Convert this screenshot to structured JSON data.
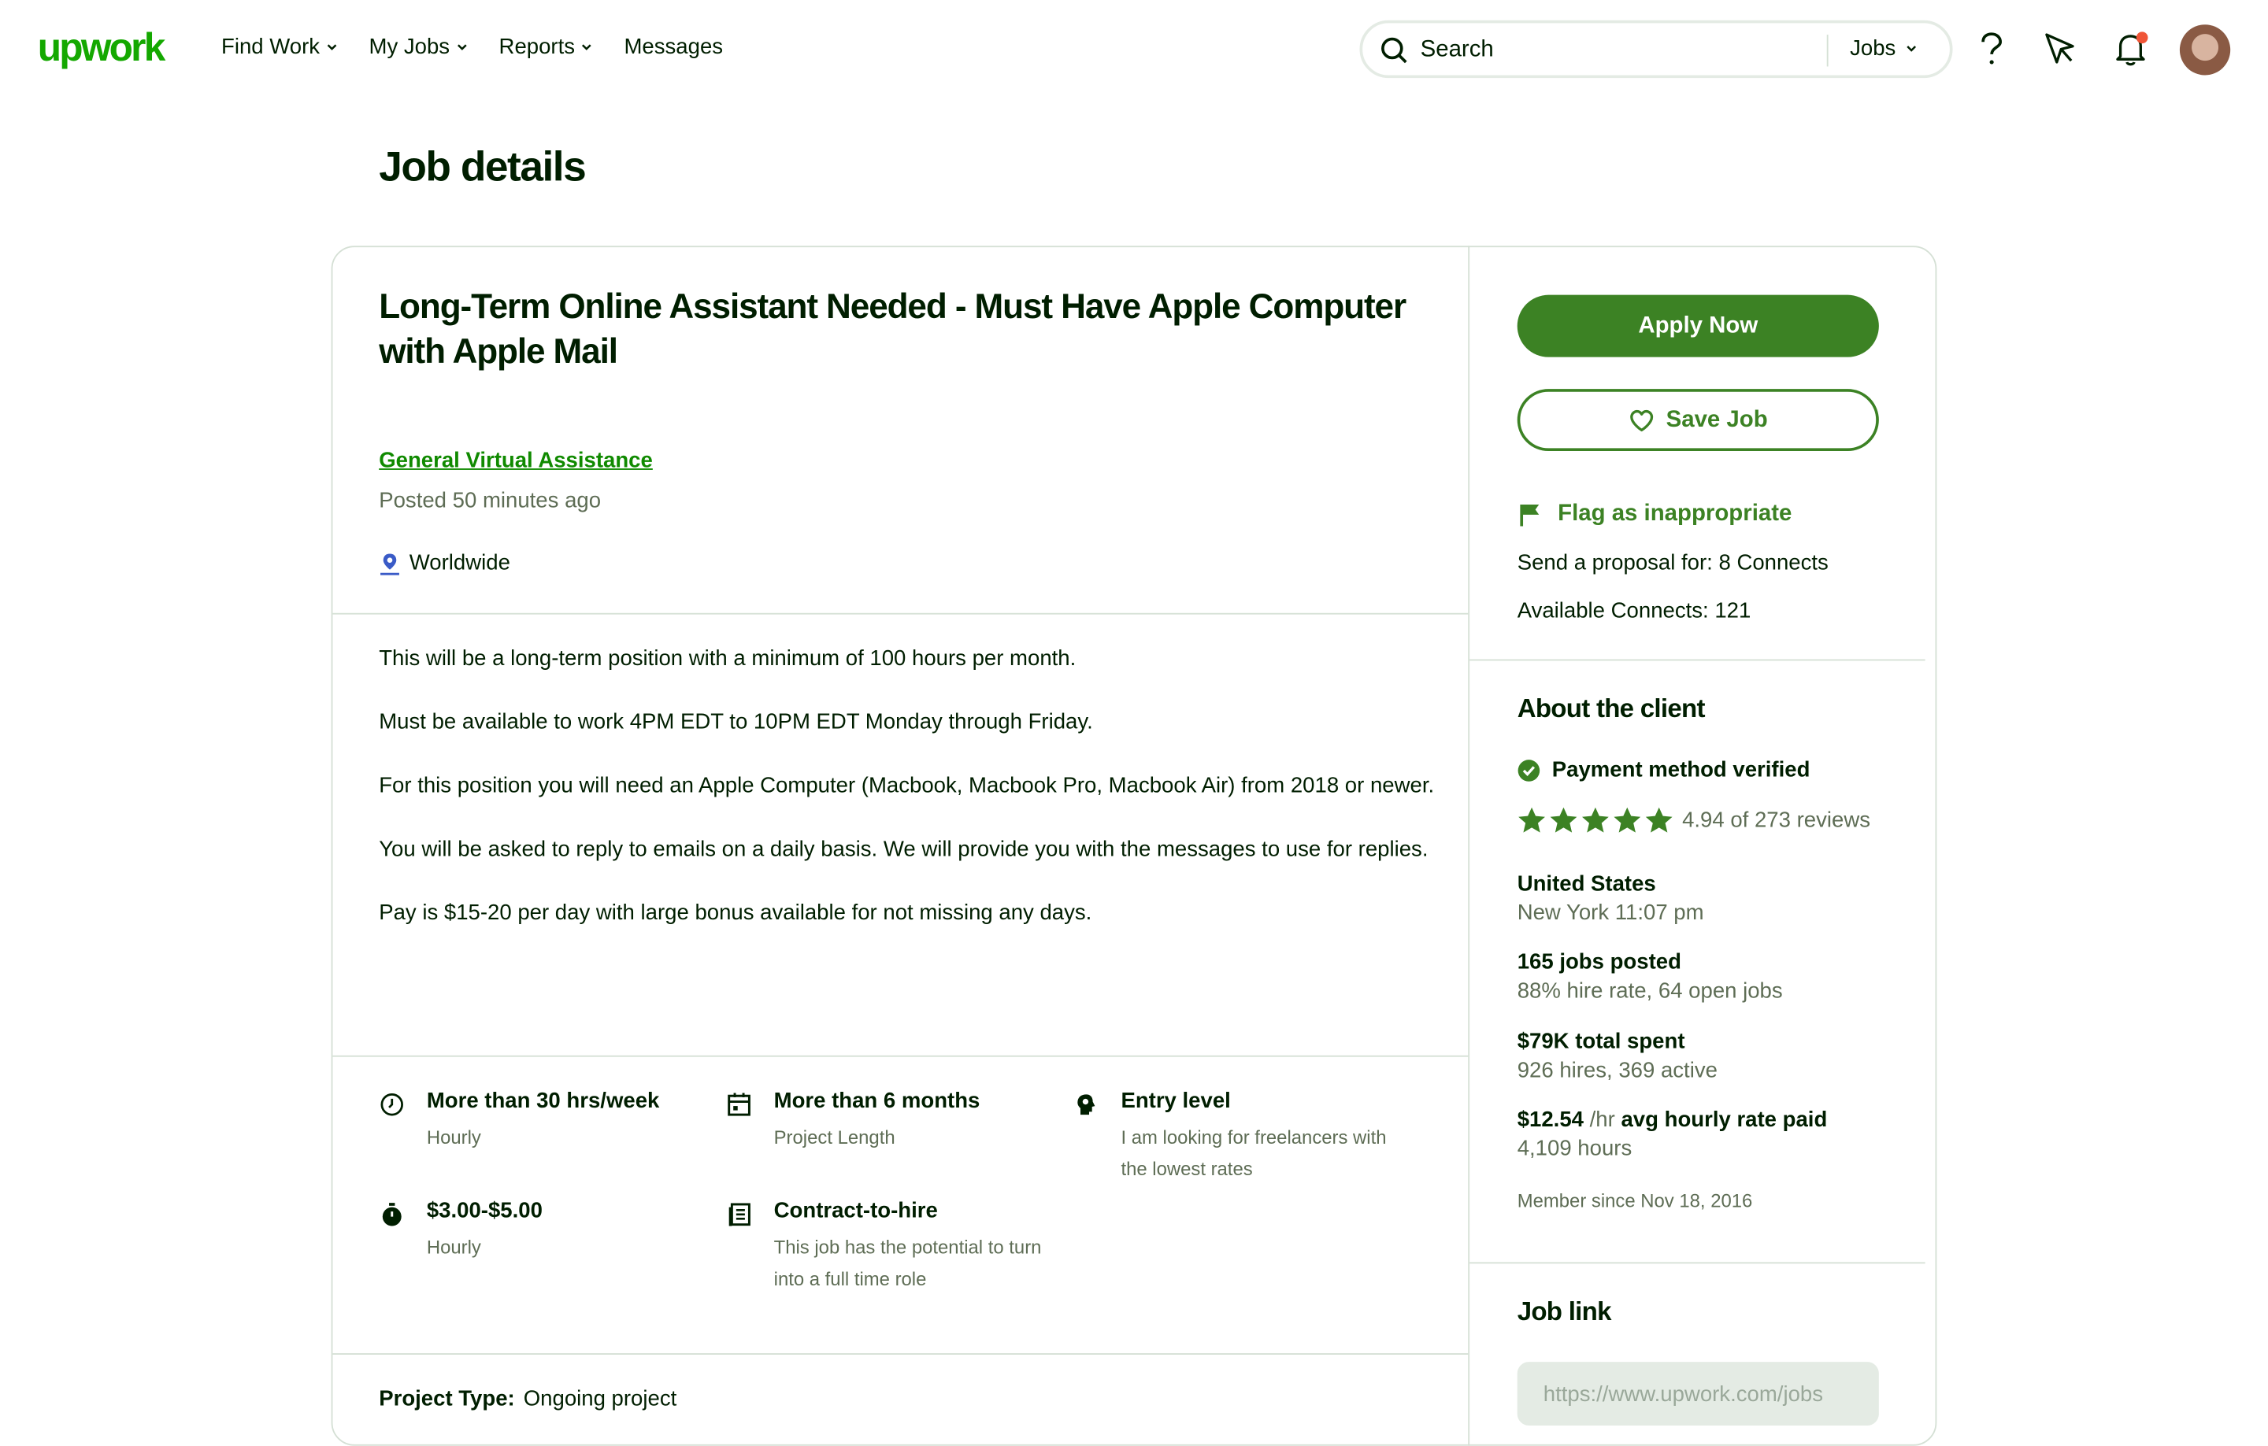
{
  "nav": {
    "logo": "upwork",
    "links": [
      "Find Work",
      "My Jobs",
      "Reports",
      "Messages"
    ],
    "search_placeholder": "Search",
    "search_scope": "Jobs",
    "icons": [
      "help-icon",
      "direct-contracts-icon",
      "notifications-icon",
      "avatar"
    ]
  },
  "page_title": "Job details",
  "job": {
    "title": "Long-Term Online Assistant Needed - Must Have Apple Computer with Apple Mail",
    "category": "General Virtual Assistance",
    "posted": "Posted 50 minutes ago",
    "location": "Worldwide",
    "description": [
      "This will be a long-term position with a minimum of 100 hours per month.",
      "Must be available to work 4PM EDT to 10PM EDT Monday through Friday.",
      "For this position you will need an Apple Computer (Macbook, Macbook Pro, Macbook Air) from 2018 or newer.",
      "You will be asked to reply to emails on a daily basis. We will provide you with the messages to use for replies.",
      "Pay is $15-20 per day with large bonus available for not missing any days."
    ],
    "features": [
      {
        "title": "More than 30 hrs/week",
        "sub": "Hourly",
        "icon": "clock-icon"
      },
      {
        "title": "More than 6 months",
        "sub": "Project Length",
        "icon": "calendar-icon"
      },
      {
        "title": "Entry level",
        "sub": "I am looking for freelancers with the lowest rates",
        "icon": "head-icon"
      },
      {
        "title": "$3.00-$5.00",
        "sub": "Hourly",
        "icon": "stopwatch-icon"
      },
      {
        "title": "Contract-to-hire",
        "sub": "This job has the potential to turn into a full time role",
        "icon": "document-icon"
      }
    ],
    "project_type_label": "Project Type:",
    "project_type_value": "Ongoing project"
  },
  "sidebar": {
    "apply_label": "Apply Now",
    "save_label": "Save Job",
    "flag_label": "Flag as inappropriate",
    "proposal_cost": "Send a proposal for: 8 Connects",
    "available_connects": "Available Connects: 121",
    "about_title": "About the client",
    "payment_verified": "Payment method verified",
    "rating_value": 4.94,
    "rating_text": "4.94 of 273 reviews",
    "country": "United States",
    "city_time": "New York 11:07 pm",
    "jobs_posted": "165 jobs posted",
    "hire_rate": "88% hire rate, 64 open jobs",
    "total_spent": "$79K total spent",
    "hires": "926 hires, 369 active",
    "avg_rate_value": "$12.54",
    "avg_rate_unit": "/hr",
    "avg_rate_label": "avg hourly rate paid",
    "hours": "4,109 hours",
    "member_since": "Member since Nov 18, 2016",
    "job_link_title": "Job link",
    "job_link_value": "https://www.upwork.com/jobs"
  },
  "colors": {
    "brand_green": "#14a800",
    "button_green": "#3c8224",
    "text": "#001e00",
    "muted": "#5e6d55",
    "border": "#d5e0d5",
    "notification_dot": "#f05537"
  }
}
